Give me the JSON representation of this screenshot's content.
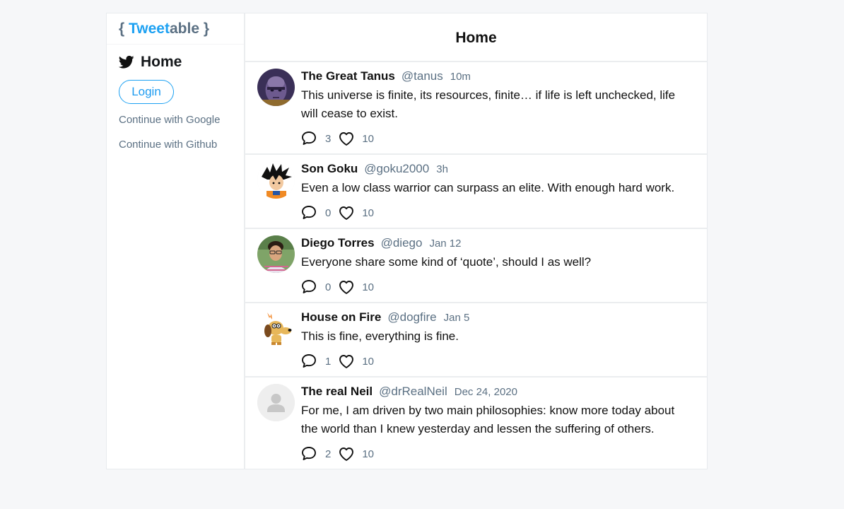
{
  "brand": {
    "open_brace": "{ ",
    "tweet": "Tweet",
    "able": "able",
    "close_brace": " }"
  },
  "sidebar": {
    "home_label": "Home",
    "login_label": "Login",
    "google_label": "Continue with Google",
    "github_label": "Continue with Github"
  },
  "main": {
    "title": "Home"
  },
  "tweets": [
    {
      "name": "The Great Tanus",
      "handle": "@tanus",
      "time": "10m",
      "content": "This universe is finite, its resources, finite… if life is left unchecked, life will cease to exist.",
      "comments": "3",
      "likes": "10"
    },
    {
      "name": "Son Goku",
      "handle": "@goku2000",
      "time": "3h",
      "content": "Even a low class warrior can surpass an elite. With enough hard work.",
      "comments": "0",
      "likes": "10"
    },
    {
      "name": "Diego Torres",
      "handle": "@diego",
      "time": "Jan 12",
      "content": "Everyone share some kind of ‘quote’, should I as well?",
      "comments": "0",
      "likes": "10"
    },
    {
      "name": "House on Fire",
      "handle": "@dogfire",
      "time": "Jan 5",
      "content": "This is fine, everything is fine.",
      "comments": "1",
      "likes": "10"
    },
    {
      "name": "The real Neil",
      "handle": "@drRealNeil",
      "time": "Dec 24, 2020",
      "content": "For me, I am driven by two main philosophies: know more today about the world than I knew yesterday and lessen the suffering of others.",
      "comments": "2",
      "likes": "10"
    }
  ],
  "colors": {
    "accent": "#1da1f2",
    "muted": "#5b7083",
    "background": "#f6f7f9"
  },
  "icons": {
    "home": "bird-icon",
    "comment": "comment-icon",
    "like": "heart-icon"
  }
}
